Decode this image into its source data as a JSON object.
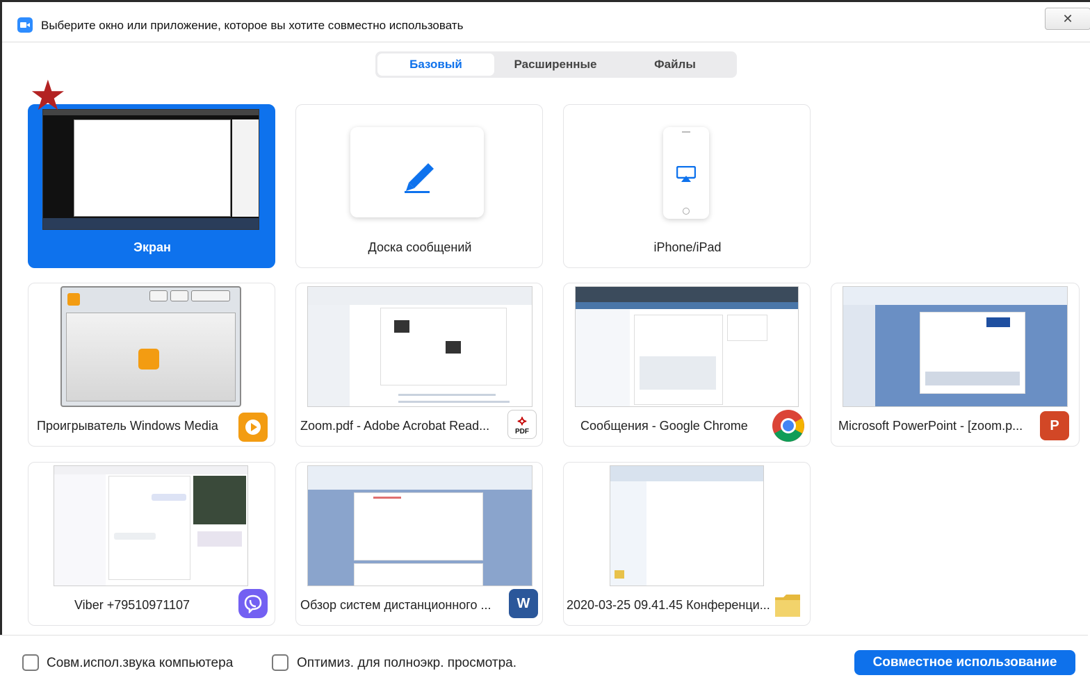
{
  "window": {
    "title": "Выберите окно или приложение, которое вы хотите совместно использовать",
    "close_glyph": "✕"
  },
  "tabs": [
    {
      "label": "Базовый",
      "active": true
    },
    {
      "label": "Расширенные",
      "active": false
    },
    {
      "label": "Файлы",
      "active": false
    }
  ],
  "cards": {
    "screen": {
      "label": "Экран",
      "selected": true
    },
    "whiteboard": {
      "label": "Доска сообщений"
    },
    "iphone": {
      "label": "iPhone/iPad"
    },
    "wmp": {
      "label": "Проигрыватель Windows Media",
      "icon": "windows-media-player-icon"
    },
    "acrobat": {
      "label": "Zoom.pdf - Adobe Acrobat Read...",
      "icon": "pdf-icon",
      "badge_text": "PDF"
    },
    "chrome": {
      "label": "Сообщения - Google Chrome",
      "icon": "chrome-icon"
    },
    "powerpoint": {
      "label": "Microsoft PowerPoint - [zoom.p...",
      "icon": "powerpoint-icon",
      "badge_text": "P"
    },
    "viber": {
      "label": "Viber +79510971107",
      "icon": "viber-icon"
    },
    "word": {
      "label": "Обзор систем дистанционного ...",
      "icon": "word-icon",
      "badge_text": "W"
    },
    "folder": {
      "label": "2020-03-25 09.41.45 Конференци...",
      "icon": "folder-icon"
    }
  },
  "options": {
    "share_audio": {
      "label": "Совм.испол.звука компьютера",
      "checked": false
    },
    "optimize_video": {
      "label": "Оптимиз. для полноэкр. просмотра.",
      "checked": false
    }
  },
  "share_button": "Совместное использование",
  "colors": {
    "accent": "#0e72ed",
    "star": "#b32222"
  }
}
